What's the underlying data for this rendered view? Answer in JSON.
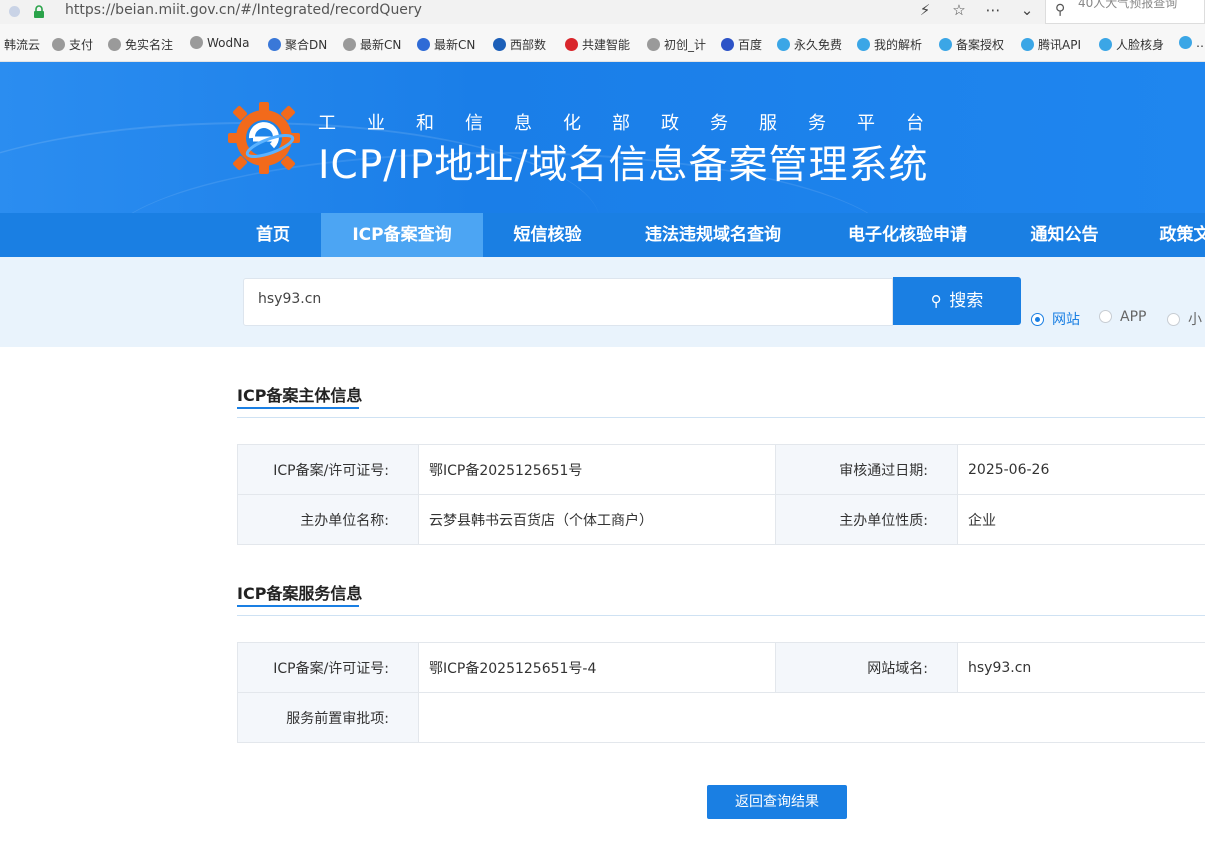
{
  "browser": {
    "url": "https://beian.miit.gov.cn/#/Integrated/recordQuery",
    "search_placeholder": "40人大气预报查询"
  },
  "bookmarks": [
    {
      "label": "韩流云",
      "color": "#ffffff"
    },
    {
      "label": "支付",
      "color": "#9a9a9a"
    },
    {
      "label": "免实名注",
      "color": "#9a9a9a"
    },
    {
      "label": "WodNa",
      "color": "#9a9a9a"
    },
    {
      "label": "聚合DN",
      "color": "#3a78d8"
    },
    {
      "label": "最新CN",
      "color": "#9a9a9a"
    },
    {
      "label": "最新CN",
      "color": "#2f6bd6"
    },
    {
      "label": "西部数",
      "color": "#1c5fb8"
    },
    {
      "label": "共建智能",
      "color": "#d9262c"
    },
    {
      "label": "初创_计",
      "color": "#9a9a9a"
    },
    {
      "label": "百度",
      "color": "#2d53c7"
    },
    {
      "label": "永久免费",
      "color": "#3ba6e6"
    },
    {
      "label": "我的解析",
      "color": "#3ba6e6"
    },
    {
      "label": "备案授权",
      "color": "#3ba6e6"
    },
    {
      "label": "腾讯API",
      "color": "#3ba6e6"
    },
    {
      "label": "人脸核身",
      "color": "#3ba6e6"
    },
    {
      "label": "…",
      "color": "#3ba6e6"
    }
  ],
  "header": {
    "subtitle": "工业和信息化部政务服务平台",
    "title": "ICP/IP地址/域名信息备案管理系统"
  },
  "nav": [
    {
      "label": "首页",
      "active": false
    },
    {
      "label": "ICP备案查询",
      "active": true
    },
    {
      "label": "短信核验",
      "active": false
    },
    {
      "label": "违法违规域名查询",
      "active": false
    },
    {
      "label": "电子化核验申请",
      "active": false
    },
    {
      "label": "通知公告",
      "active": false
    },
    {
      "label": "政策文",
      "active": false
    }
  ],
  "search": {
    "value": "hsy93.cn",
    "button_label": "搜索",
    "types": [
      {
        "label": "网站",
        "checked": true
      },
      {
        "label": "APP",
        "checked": false
      },
      {
        "label": "小",
        "checked": false
      }
    ]
  },
  "subject": {
    "title": "ICP备案主体信息",
    "rows": [
      [
        {
          "label": "ICP备案/许可证号:",
          "value": "鄂ICP备2025125651号"
        },
        {
          "label": "审核通过日期:",
          "value": "2025-06-26"
        }
      ],
      [
        {
          "label": "主办单位名称:",
          "value": "云梦县韩书云百货店（个体工商户）"
        },
        {
          "label": "主办单位性质:",
          "value": "企业"
        }
      ]
    ]
  },
  "service": {
    "title": "ICP备案服务信息",
    "rows": [
      [
        {
          "label": "ICP备案/许可证号:",
          "value": "鄂ICP备2025125651号-4"
        },
        {
          "label": "网站域名:",
          "value": "hsy93.cn"
        }
      ],
      [
        {
          "label": "服务前置审批项:",
          "value": ""
        }
      ]
    ]
  },
  "back_button": "返回查询结果",
  "colors": {
    "primary": "#1a7fe3",
    "nav_active": "#4ca5f3",
    "search_bg": "#e9f3fc"
  }
}
